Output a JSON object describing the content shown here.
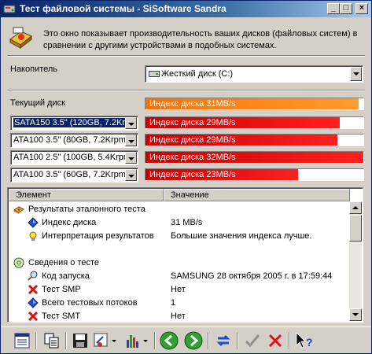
{
  "window": {
    "title": "Тест файловой системы - SiSoftware Sandra"
  },
  "intro": {
    "text": "Это окно показывает производительность ваших дисков (файловых систем) в сравнении с другими устройствами в подобных системах."
  },
  "drive": {
    "label": "Накопитель",
    "value": "Жесткий диск (C:)"
  },
  "current": {
    "label": "Текущий диск",
    "bar_text": "Индекс диска 31MB/s",
    "level": 0.98
  },
  "comparisons": [
    {
      "device": "SATA150 3.5\" (120GB, 7.2Krpm",
      "bar_text": "Индекс диска 29MB/s",
      "level": 0.89
    },
    {
      "device": "ATA100 3.5\" (80GB, 7.2Krpm, 8",
      "bar_text": "Индекс диска 29MB/s",
      "level": 0.88
    },
    {
      "device": "ATA100 2.5\" (100GB, 5.4Krpm",
      "bar_text": "Индекс диска 32MB/s",
      "level": 1.0
    },
    {
      "device": "ATA100 3.5\" (60GB, 7.2Krpm, 8",
      "bar_text": "Индекс диска 23MB/s",
      "level": 0.7
    }
  ],
  "list": {
    "columns": [
      "Элемент",
      "Значение"
    ],
    "rows": [
      {
        "icon": "hard-drive-icon",
        "key": "Результаты эталонного теста",
        "value": ""
      },
      {
        "icon": "blue-diamond-icon",
        "key": "Индекс диска",
        "value": "31 MB/s"
      },
      {
        "icon": "lightbulb-icon",
        "key": "Интерпретация результатов",
        "value": "Большие значения индекса лучше."
      },
      {
        "icon": "",
        "key": "",
        "value": ""
      },
      {
        "icon": "cd-disc-icon",
        "key": "Сведения о тесте",
        "value": ""
      },
      {
        "icon": "magnifier-icon",
        "key": "Код запуска",
        "value": "SAMSUNG 28 октября 2005 г. в 17:59:44"
      },
      {
        "icon": "red-x-icon",
        "key": "Тест SMP",
        "value": "Нет"
      },
      {
        "icon": "blue-diamond-icon",
        "key": "Всего тестовых потоков",
        "value": "1"
      },
      {
        "icon": "red-x-icon",
        "key": "Тест SMT",
        "value": "Нет"
      }
    ]
  },
  "colors": {
    "title_start": "#0a246a",
    "current_bar": "#ff8a20",
    "compare_bar": "#e01010"
  }
}
